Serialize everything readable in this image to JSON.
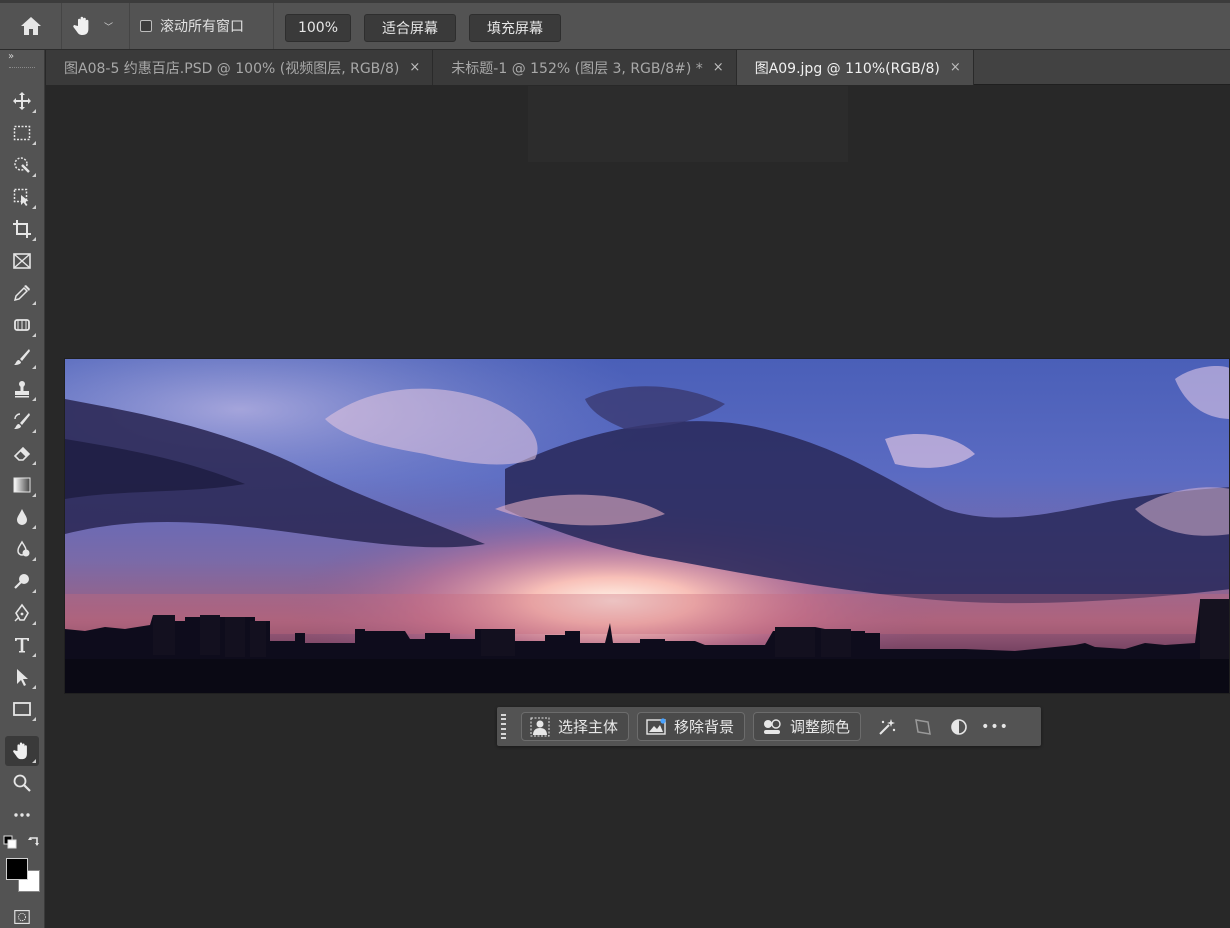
{
  "options_bar": {
    "scroll_all_label": "滚动所有窗口",
    "zoom_value": "100%",
    "fit_screen_label": "适合屏幕",
    "fill_screen_label": "填充屏幕"
  },
  "tabs": [
    {
      "label": "图A08-5 约惠百店.PSD @ 100% (视频图层, RGB/8)",
      "close": "×",
      "active": false
    },
    {
      "label": "未标题-1 @ 152% (图层 3, RGB/8#) *",
      "close": "×",
      "active": false
    },
    {
      "label": "图A09.jpg @ 110%(RGB/8)",
      "close": "×",
      "active": true
    }
  ],
  "toolbar": {
    "collapse_glyph": "»",
    "tools": [
      "move-tool",
      "marquee-tool",
      "quick-selection-tool",
      "object-selection-tool",
      "crop-tool",
      "frame-tool",
      "eyedropper-tool",
      "healing-brush-tool",
      "brush-tool",
      "clone-stamp-tool",
      "history-brush-tool",
      "eraser-tool",
      "gradient-tool",
      "blur-tool",
      "sponge-tool",
      "dodge-tool",
      "pen-tool",
      "type-tool",
      "path-selection-tool",
      "rectangle-tool",
      "hand-tool",
      "zoom-tool",
      "more-tools"
    ],
    "active_tool": "hand-tool",
    "foreground_color": "#000000",
    "background_color": "#ffffff"
  },
  "contextual_bar": {
    "select_subject_label": "选择主体",
    "remove_background_label": "移除背景",
    "adjust_color_label": "调整颜色",
    "more_glyph": "•••"
  },
  "colors": {
    "panel": "#535353",
    "canvas_bg": "#282828",
    "tab_active": "#4c4c4c"
  }
}
